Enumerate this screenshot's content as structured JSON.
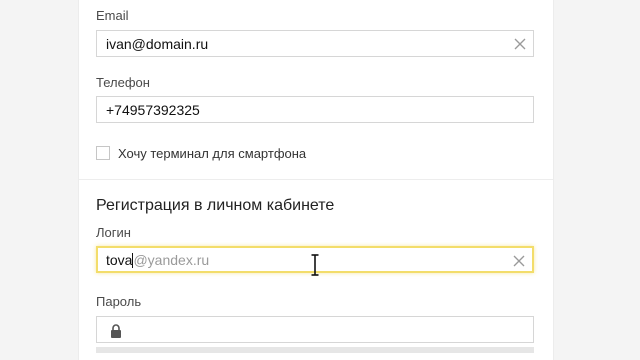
{
  "form": {
    "email": {
      "label": "Email",
      "value": "ivan@domain.ru"
    },
    "phone": {
      "label": "Телефон",
      "value": "+74957392325"
    },
    "terminal_checkbox": {
      "label": "Хочу терминал для смартфона",
      "checked": false
    },
    "registration_section": {
      "title": "Регистрация в личном кабинете"
    },
    "login": {
      "label": "Логин",
      "typed": "tova",
      "suffix": "@yandex.ru"
    },
    "password": {
      "label": "Пароль",
      "value": ""
    }
  },
  "icons": {
    "clear": "close-icon",
    "lock": "lock-icon",
    "cursor": "text-cursor-icon"
  },
  "colors": {
    "focus_border": "#f3dd6a",
    "suffix_text": "#9a9a9a",
    "field_border": "#d6d6d6"
  }
}
